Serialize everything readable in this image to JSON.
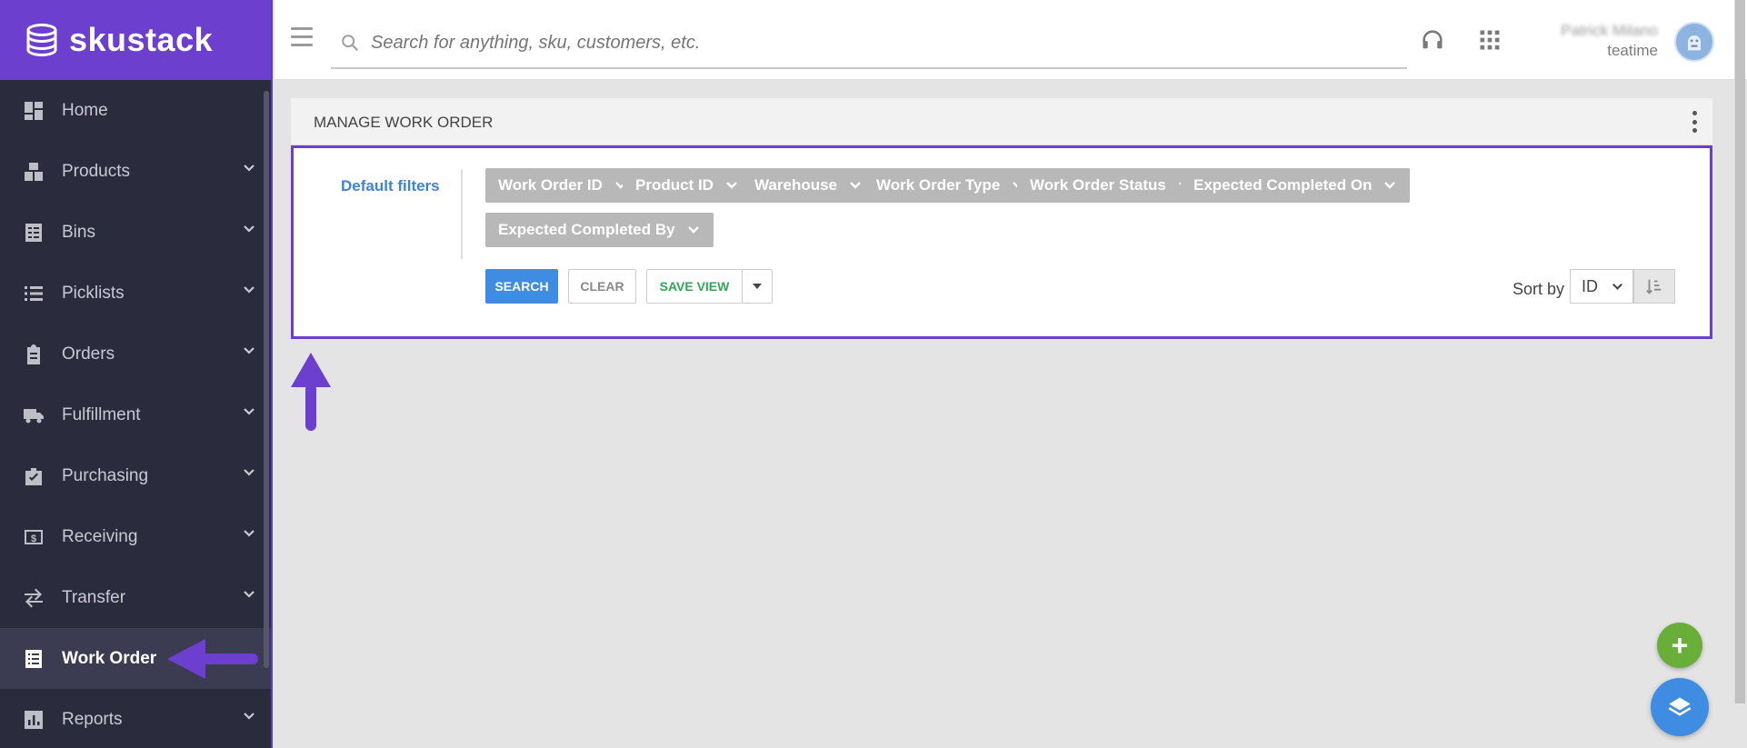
{
  "brand": {
    "name": "skustack"
  },
  "sidebar": {
    "items": [
      {
        "label": "Home",
        "icon": "dashboard-icon",
        "has_chevron": false,
        "active": false
      },
      {
        "label": "Products",
        "icon": "products-icon",
        "has_chevron": true,
        "active": false
      },
      {
        "label": "Bins",
        "icon": "bins-icon",
        "has_chevron": true,
        "active": false
      },
      {
        "label": "Picklists",
        "icon": "list-icon",
        "has_chevron": true,
        "active": false
      },
      {
        "label": "Orders",
        "icon": "clipboard-icon",
        "has_chevron": true,
        "active": false
      },
      {
        "label": "Fulfillment",
        "icon": "truck-icon",
        "has_chevron": true,
        "active": false
      },
      {
        "label": "Purchasing",
        "icon": "clipboard-check-icon",
        "has_chevron": true,
        "active": false
      },
      {
        "label": "Receiving",
        "icon": "dollar-box-icon",
        "has_chevron": true,
        "active": false
      },
      {
        "label": "Transfer",
        "icon": "swap-icon",
        "has_chevron": true,
        "active": false
      },
      {
        "label": "Work Order",
        "icon": "work-order-icon",
        "has_chevron": false,
        "active": true
      },
      {
        "label": "Reports",
        "icon": "chart-icon",
        "has_chevron": true,
        "active": false
      }
    ]
  },
  "topbar": {
    "search_placeholder": "Search for anything, sku, customers, etc.",
    "user_name": "Patrick Milano",
    "user_subtitle": "teatime",
    "icons": [
      "menu-icon",
      "search-icon",
      "headset-icon",
      "apps-grid-icon",
      "avatar-icon"
    ]
  },
  "panel": {
    "title": "MANAGE WORK ORDER",
    "default_filters_label": "Default filters",
    "filters": [
      "Work Order ID",
      "Product ID",
      "Warehouse",
      "Work Order Type",
      "Work Order Status",
      "Expected Completed On",
      "Expected Completed By"
    ],
    "buttons": {
      "search": "SEARCH",
      "clear": "CLEAR",
      "save_view": "SAVE VIEW"
    },
    "sort": {
      "label": "Sort by",
      "value": "ID"
    }
  },
  "colors": {
    "brand_purple": "#6c3fcf",
    "sidebar_bg": "#2a2b3d",
    "filter_chip": "#b8b8b8",
    "search_button": "#3e8de3",
    "save_view_text": "#2fa855",
    "fab_add": "#6aae3a",
    "fab_layers": "#3e8de3"
  }
}
